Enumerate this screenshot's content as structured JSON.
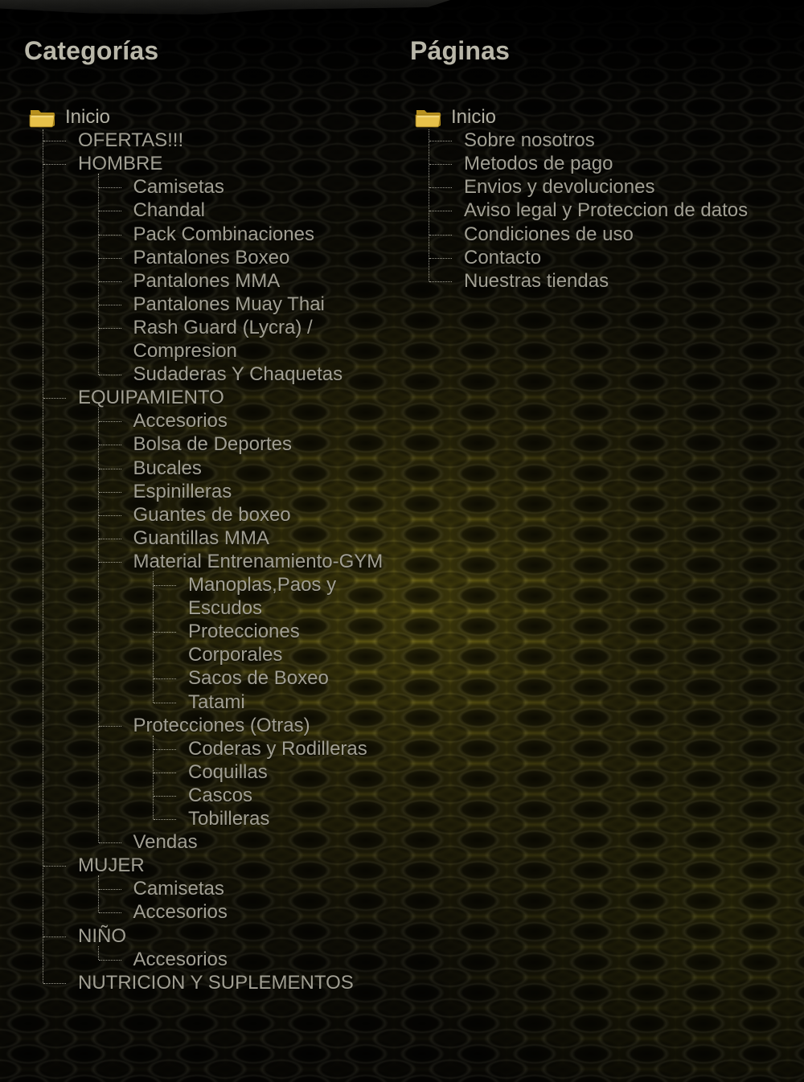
{
  "colors": {
    "heading": "#b9b7a9",
    "link": "#a19f93",
    "tree_line": "#cfcdbf",
    "folder": "#e8c24a"
  },
  "categories": {
    "title": "Categorías",
    "root": "Inicio",
    "items": [
      {
        "label": "OFERTAS!!!",
        "children": []
      },
      {
        "label": "HOMBRE",
        "children": [
          {
            "label": "Camisetas",
            "children": []
          },
          {
            "label": "Chandal",
            "children": []
          },
          {
            "label": "Pack Combinaciones",
            "children": []
          },
          {
            "label": "Pantalones Boxeo",
            "children": []
          },
          {
            "label": "Pantalones MMA",
            "children": []
          },
          {
            "label": "Pantalones Muay Thai",
            "children": []
          },
          {
            "label": "Rash Guard (Lycra) / Compresion",
            "lines": [
              "Rash Guard (Lycra) /",
              "Compresion"
            ],
            "children": []
          },
          {
            "label": "Sudaderas Y Chaquetas",
            "children": []
          }
        ]
      },
      {
        "label": "EQUIPAMIENTO",
        "children": [
          {
            "label": "Accesorios",
            "children": []
          },
          {
            "label": "Bolsa de Deportes",
            "children": []
          },
          {
            "label": "Bucales",
            "children": []
          },
          {
            "label": "Espinilleras",
            "children": []
          },
          {
            "label": "Guantes de boxeo",
            "children": []
          },
          {
            "label": "Guantillas MMA",
            "children": []
          },
          {
            "label": "Material Entrenamiento-GYM",
            "children": [
              {
                "label": "Manoplas,Paos y Escudos",
                "lines": [
                  "Manoplas,Paos y",
                  "Escudos"
                ],
                "children": []
              },
              {
                "label": "Protecciones Corporales",
                "lines": [
                  "Protecciones",
                  "Corporales"
                ],
                "children": []
              },
              {
                "label": "Sacos de Boxeo",
                "children": []
              },
              {
                "label": "Tatami",
                "children": []
              }
            ]
          },
          {
            "label": "Protecciones (Otras)",
            "children": [
              {
                "label": "Coderas y Rodilleras",
                "children": []
              },
              {
                "label": "Coquillas",
                "children": []
              },
              {
                "label": "Cascos",
                "children": []
              },
              {
                "label": "Tobilleras",
                "children": []
              }
            ]
          },
          {
            "label": "Vendas",
            "children": []
          }
        ]
      },
      {
        "label": "MUJER",
        "children": [
          {
            "label": "Camisetas",
            "children": []
          },
          {
            "label": "Accesorios",
            "children": []
          }
        ]
      },
      {
        "label": "NIÑO",
        "children": [
          {
            "label": "Accesorios",
            "children": []
          }
        ]
      },
      {
        "label": "NUTRICION Y SUPLEMENTOS",
        "children": []
      }
    ]
  },
  "pages": {
    "title": "Páginas",
    "root": "Inicio",
    "items": [
      {
        "label": "Sobre nosotros",
        "children": []
      },
      {
        "label": "Metodos de pago",
        "children": []
      },
      {
        "label": "Envios y devoluciones",
        "children": []
      },
      {
        "label": "Aviso legal y Proteccion de datos",
        "children": []
      },
      {
        "label": "Condiciones de uso",
        "children": []
      },
      {
        "label": "Contacto",
        "children": []
      },
      {
        "label": "Nuestras tiendas",
        "children": []
      }
    ]
  }
}
